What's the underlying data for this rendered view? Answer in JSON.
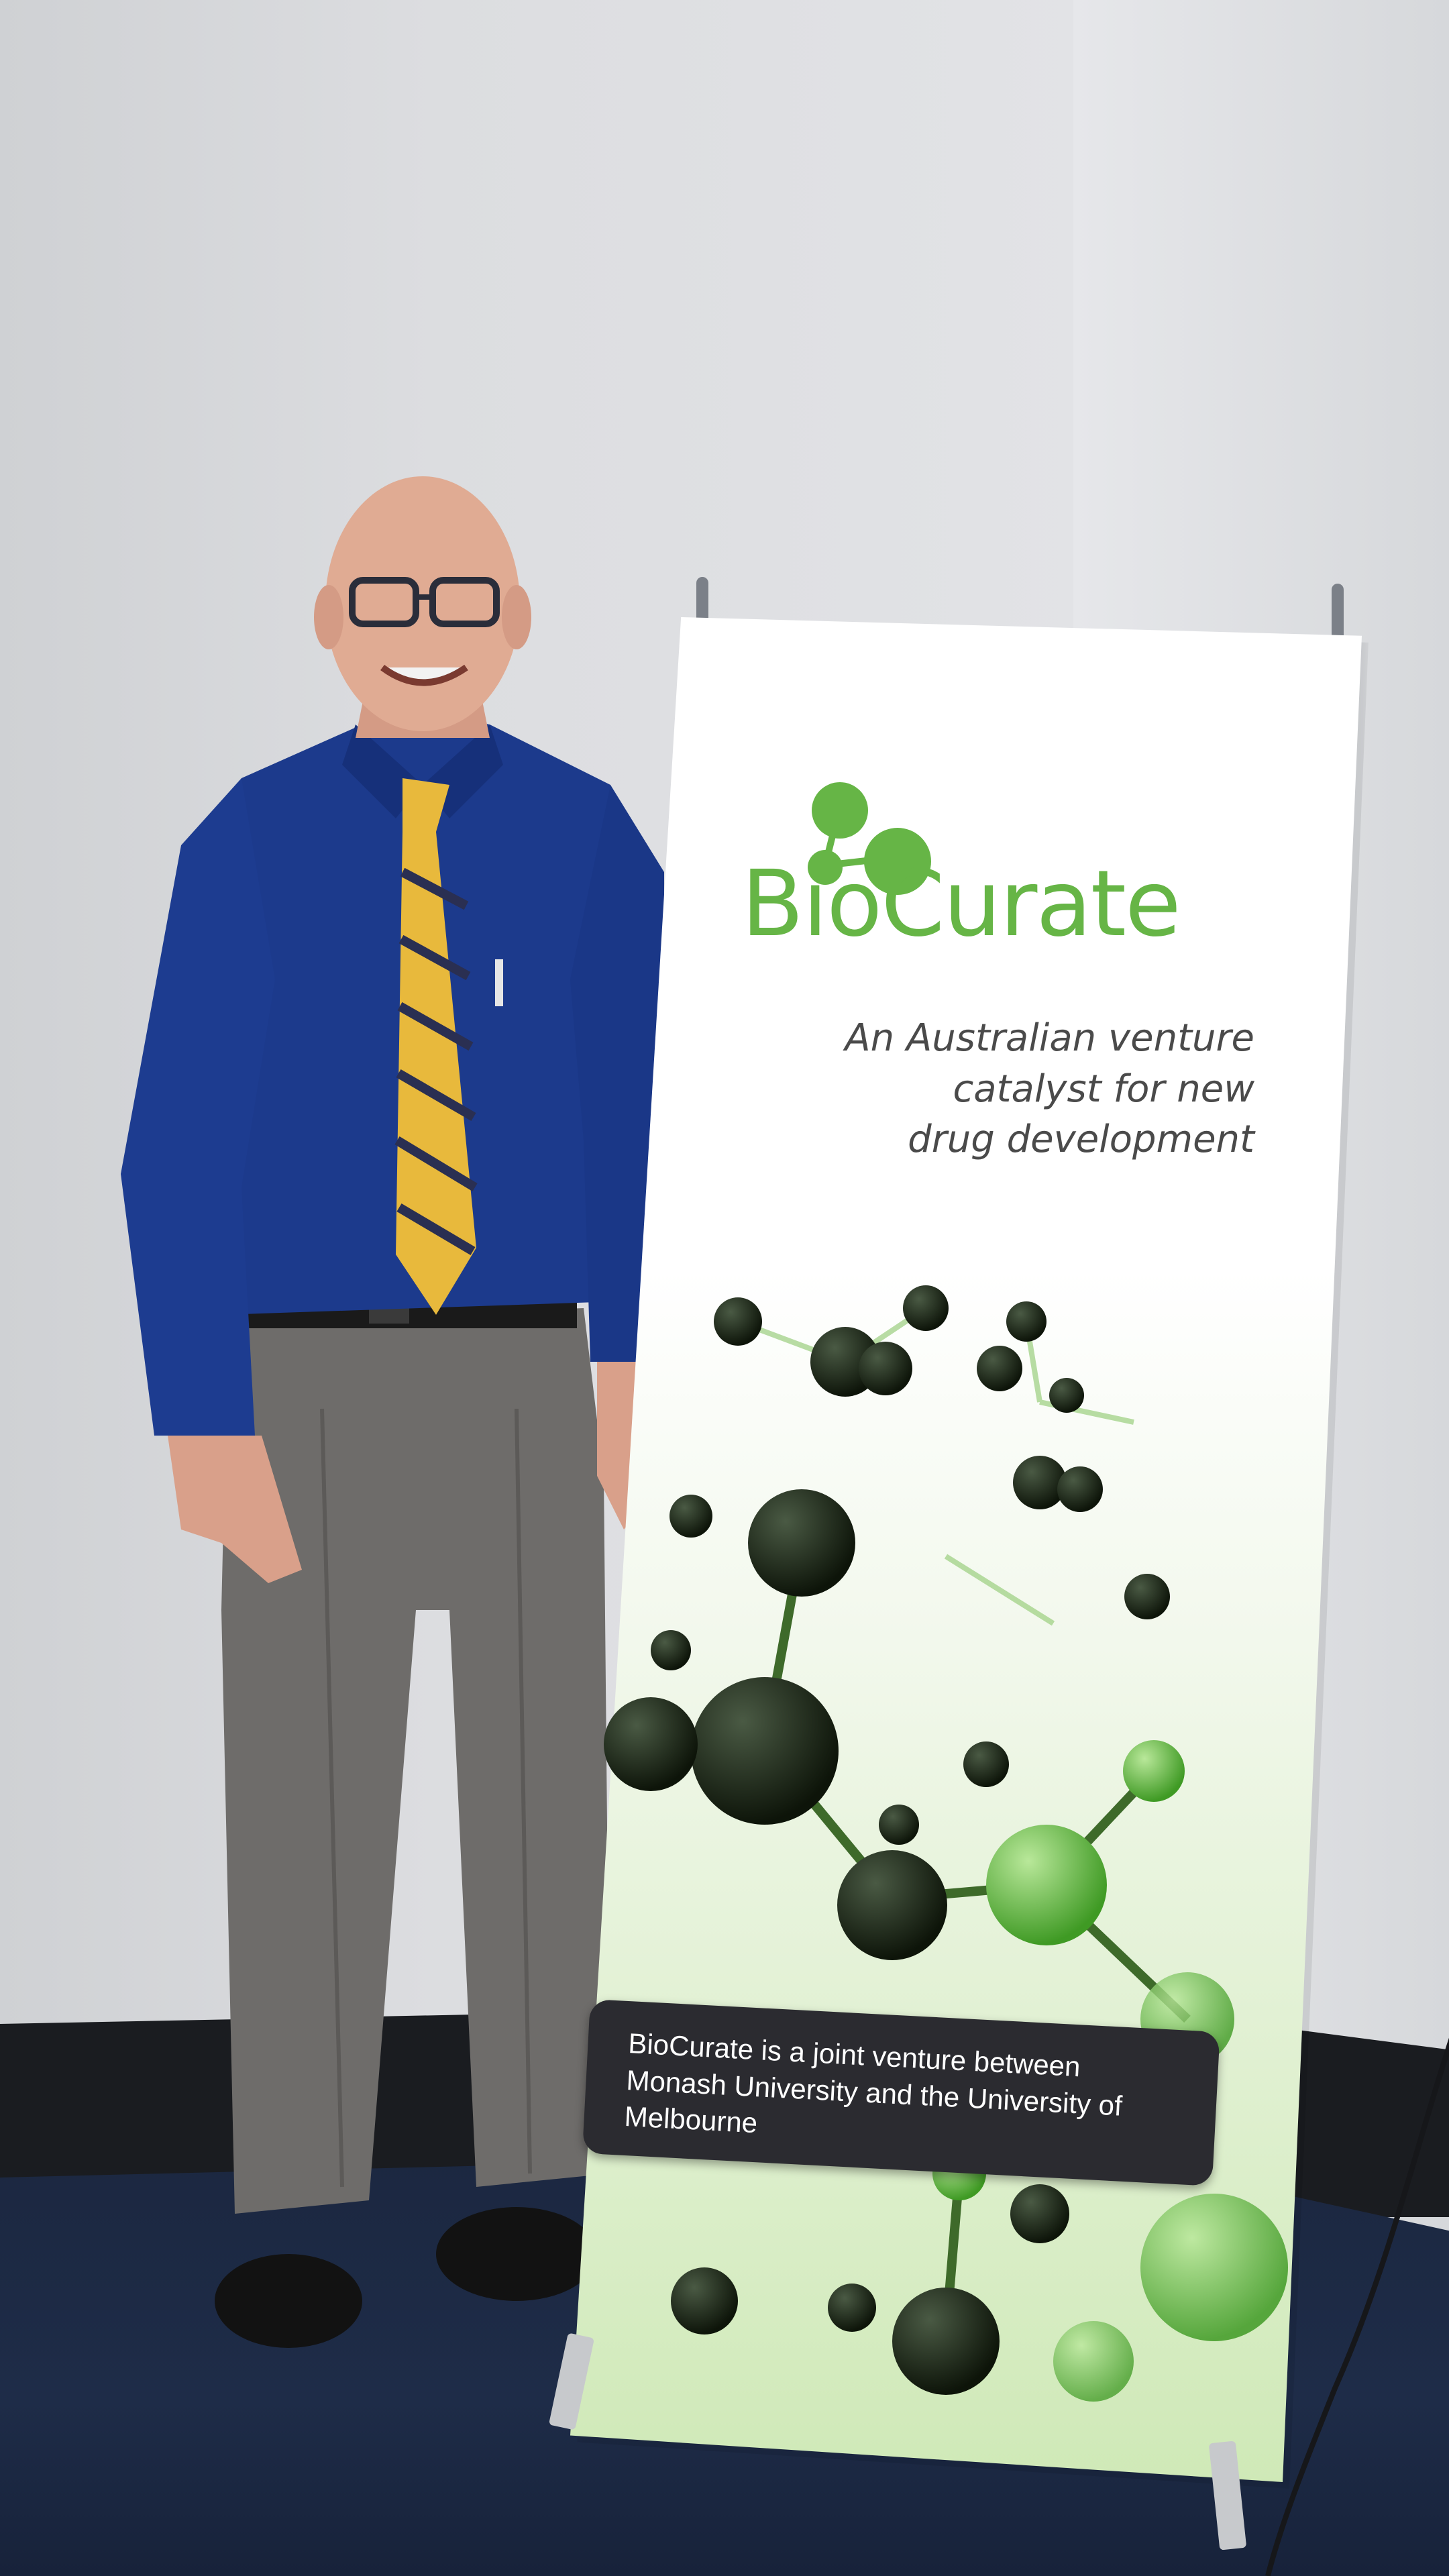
{
  "banner": {
    "brand": "BioCurate",
    "tagline_lines": [
      "An Australian venture",
      "catalyst for new",
      "drug development"
    ],
    "footer_lines": [
      "BioCurate is a joint venture between",
      "Monash University and the University of Melbourne"
    ]
  },
  "colors": {
    "brand_green": "#66b546",
    "shirt_blue": "#1c3a8c",
    "tie_yellow": "#e8b93c",
    "trousers_grey": "#6e6c6a",
    "footer_bar": "#2b2b30"
  }
}
